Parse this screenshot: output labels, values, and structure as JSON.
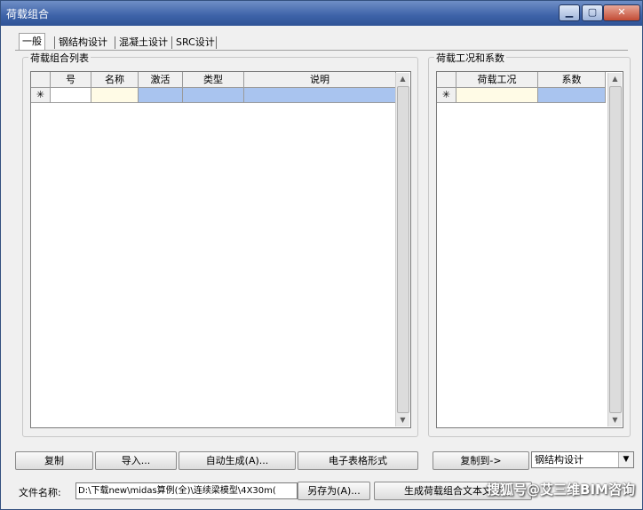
{
  "window": {
    "title": "荷载组合",
    "minimize_glyph": "▁",
    "maximize_glyph": "▢",
    "close_glyph": "✕"
  },
  "tabs": [
    {
      "label": "一般",
      "active": true
    },
    {
      "label": "钢结构设计"
    },
    {
      "label": "混凝土设计"
    },
    {
      "label": "SRC设计"
    }
  ],
  "left_panel": {
    "title": "荷载组合列表",
    "columns": [
      "号",
      "名称",
      "激活",
      "类型",
      "说明"
    ],
    "new_row_marker": "✳"
  },
  "right_panel": {
    "title": "荷载工况和系数",
    "columns": [
      "荷载工况",
      "系数"
    ],
    "new_row_marker": "✳"
  },
  "scroll": {
    "up_glyph": "▲",
    "down_glyph": "▼"
  },
  "buttons": {
    "copy": "复制",
    "import": "导入...",
    "auto_generate": "自动生成(A)...",
    "spreadsheet": "电子表格形式",
    "copy_to": "复制到->",
    "save_as": "另存为(A)...",
    "generate_text": "生成荷载组合文本文件"
  },
  "copy_to_target": {
    "value": "钢结构设计",
    "dropdown_glyph": "▼"
  },
  "file": {
    "label": "文件名称:",
    "path": "D:\\下载new\\midas算例(全)\\连续梁模型\\4X30m("
  },
  "watermark": "搜狐号@艾三维BIM咨询",
  "colors": {
    "titlebar": "#3d62a8",
    "selected_cell": "#a9c4ef",
    "input_cell": "#fffbe6"
  }
}
